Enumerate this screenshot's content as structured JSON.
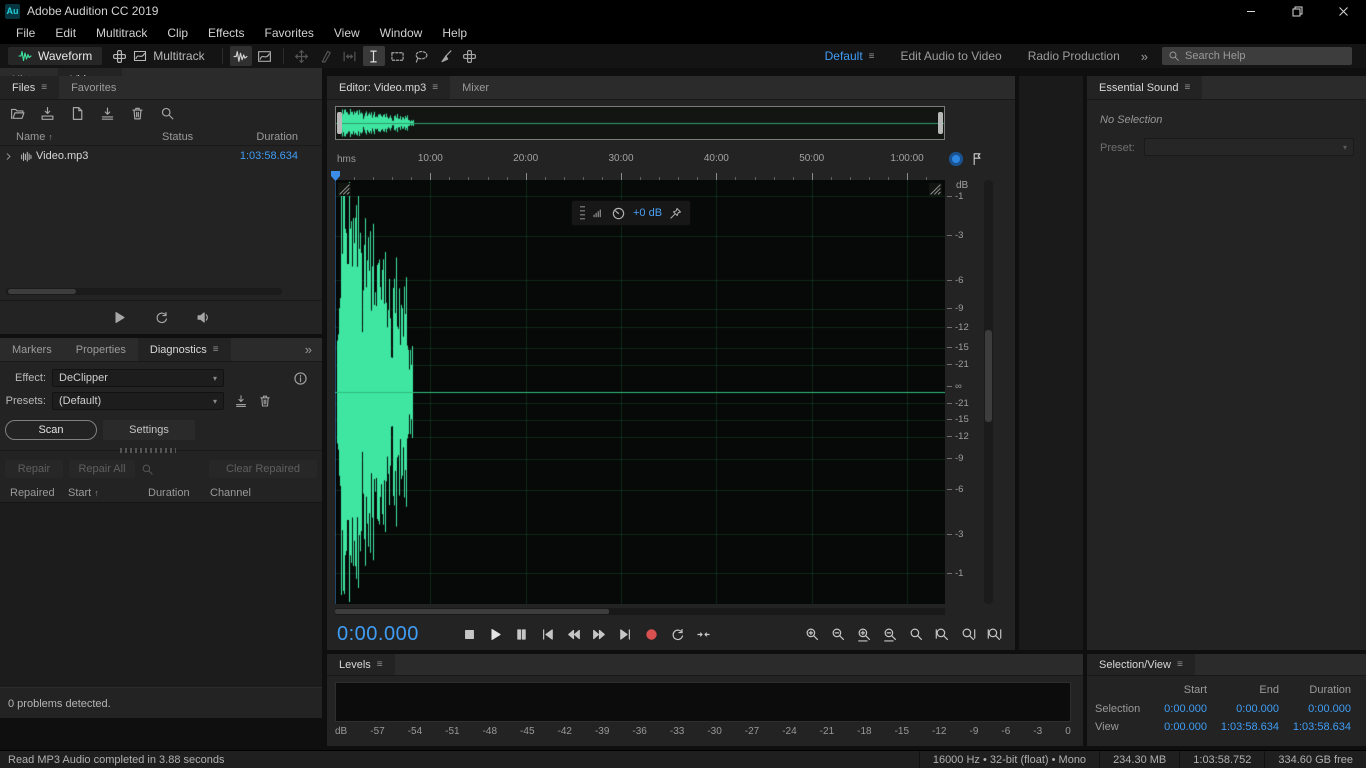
{
  "titlebar": {
    "app_icon": "Au",
    "title": "Adobe Audition CC 2019"
  },
  "menubar": [
    "File",
    "Edit",
    "Multitrack",
    "Clip",
    "Effects",
    "Favorites",
    "View",
    "Window",
    "Help"
  ],
  "mode_toolbar": {
    "waveform_label": "Waveform",
    "multitrack_label": "Multitrack",
    "view_toggles": [
      "waveform-display",
      "spectral-display"
    ],
    "tools": [
      {
        "name": "move",
        "disabled": true
      },
      {
        "name": "razor",
        "disabled": true
      },
      {
        "name": "slip",
        "disabled": true
      },
      {
        "name": "time-selection",
        "active": true
      },
      {
        "name": "marquee-selection"
      },
      {
        "name": "lasso-selection"
      },
      {
        "name": "paintbrush-selection"
      },
      {
        "name": "spot-healing-brush"
      }
    ],
    "workspaces": [
      {
        "label": "Default",
        "active": true
      },
      {
        "label": "Edit Audio to Video"
      },
      {
        "label": "Radio Production"
      }
    ],
    "search_placeholder": "Search Help"
  },
  "files_panel": {
    "tabs": [
      {
        "label": "Files",
        "active": true
      },
      {
        "label": "Favorites"
      }
    ],
    "toolbar_icons": [
      "open-file",
      "import-file",
      "new-item",
      "export",
      "delete",
      "search"
    ],
    "columns": [
      {
        "label": "Name",
        "sorted": true
      },
      {
        "label": "Status"
      },
      {
        "label": "Duration"
      }
    ],
    "file": {
      "name": "Video.mp3",
      "duration": "1:03:58.634"
    },
    "preview_icons": [
      "play",
      "loop",
      "auto-play"
    ]
  },
  "diagnostics": {
    "tabs": [
      {
        "label": "Markers"
      },
      {
        "label": "Properties"
      },
      {
        "label": "Diagnostics",
        "active": true
      }
    ],
    "effect_label": "Effect:",
    "effect_value": "DeClipper",
    "presets_label": "Presets:",
    "presets_value": "(Default)",
    "scan_button": "Scan",
    "settings_button": "Settings",
    "repair_button": "Repair",
    "repair_all_button": "Repair All",
    "clear_repaired_button": "Clear Repaired",
    "columns": [
      {
        "label": "Repaired"
      },
      {
        "label": "Start",
        "sorted": true
      },
      {
        "label": "Duration"
      },
      {
        "label": "Channel"
      }
    ],
    "status_text": "0 problems detected."
  },
  "bottom_tabs": [
    {
      "label": "History"
    },
    {
      "label": "Video",
      "active": true
    }
  ],
  "editor": {
    "tabs": [
      {
        "label": "Editor: Video.mp3",
        "active": true
      },
      {
        "label": "Mixer"
      }
    ],
    "ruler_unit": "hms",
    "ruler_ticks": [
      {
        "label": "10:00",
        "pct": 15.63
      },
      {
        "label": "20:00",
        "pct": 31.26
      },
      {
        "label": "30:00",
        "pct": 46.89
      },
      {
        "label": "40:00",
        "pct": 62.52
      },
      {
        "label": "50:00",
        "pct": 78.15
      },
      {
        "label": "1:00:00",
        "pct": 93.78
      }
    ],
    "db_unit": "dB",
    "db_ticks": [
      {
        "label": "-1",
        "pos": 3.8
      },
      {
        "label": "-3",
        "pos": 13.2
      },
      {
        "label": "-6",
        "pos": 23.6
      },
      {
        "label": "-9",
        "pos": 30.4
      },
      {
        "label": "-12",
        "pos": 34.7
      },
      {
        "label": "-15",
        "pos": 39.6
      },
      {
        "label": "-21",
        "pos": 43.6
      },
      {
        "label": "∞",
        "pos": 48.6
      },
      {
        "label": "-21",
        "pos": 52.6
      },
      {
        "label": "-15",
        "pos": 56.6
      },
      {
        "label": "-12",
        "pos": 60.6
      },
      {
        "label": "-9",
        "pos": 65.8
      },
      {
        "label": "-6",
        "pos": 73.1
      },
      {
        "label": "-3",
        "pos": 83.5
      },
      {
        "label": "-1",
        "pos": 92.7
      }
    ],
    "hud_value": "+0 dB",
    "time_display": "0:00.000",
    "transport_buttons": [
      "stop",
      "play",
      "pause",
      "skip-to-start",
      "rewind",
      "fast-forward",
      "skip-to-end",
      "record",
      "loop",
      "skip"
    ],
    "zoom_buttons": [
      "zoom-in-amplitude",
      "zoom-out-amplitude",
      "zoom-in-time",
      "zoom-out-time",
      "zoom-reset",
      "zoom-to-in-point",
      "zoom-to-out-point",
      "zoom-to-selection"
    ]
  },
  "levels": {
    "title": "Levels",
    "unit": "dB",
    "ticks": [
      "-57",
      "-54",
      "-51",
      "-48",
      "-45",
      "-42",
      "-39",
      "-36",
      "-33",
      "-30",
      "-27",
      "-24",
      "-21",
      "-18",
      "-15",
      "-12",
      "-9",
      "-6",
      "-3",
      "0"
    ]
  },
  "essential_sound": {
    "title": "Essential Sound",
    "empty_text": "No Selection",
    "preset_label": "Preset:"
  },
  "selection_view": {
    "title": "Selection/View",
    "columns": [
      "Start",
      "End",
      "Duration"
    ],
    "rows": [
      {
        "label": "Selection",
        "start": "0:00.000",
        "end": "0:00.000",
        "duration": "0:00.000"
      },
      {
        "label": "View",
        "start": "0:00.000",
        "end": "1:03:58.634",
        "duration": "1:03:58.634"
      }
    ]
  },
  "statusbar": {
    "message": "Read MP3 Audio completed in 3.88 seconds",
    "format": "16000 Hz • 32-bit (float) • Mono",
    "file_size": "234.30 MB",
    "duration": "1:03:58.752",
    "free_space": "334.60 GB free"
  },
  "colors": {
    "accent_blue": "#3f9df5",
    "waveform_green": "#3ee6a2",
    "record_red": "#d85050"
  }
}
